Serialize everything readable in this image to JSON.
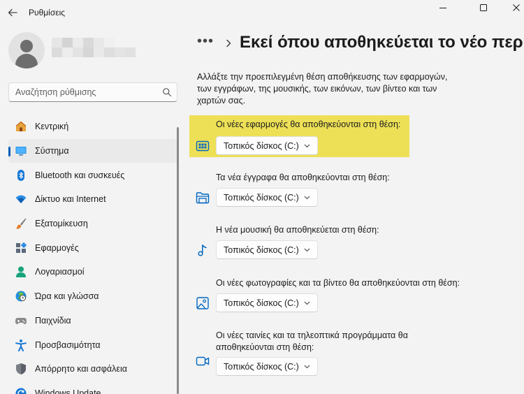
{
  "window": {
    "title": "Ρυθμίσεις"
  },
  "search": {
    "placeholder": "Αναζήτηση ρύθμισης"
  },
  "sidebar": {
    "items": [
      {
        "label": "Κεντρική",
        "icon": "home-icon"
      },
      {
        "label": "Σύστημα",
        "icon": "system-icon",
        "selected": true
      },
      {
        "label": "Bluetooth και συσκευές",
        "icon": "bluetooth-icon"
      },
      {
        "label": "Δίκτυο και Internet",
        "icon": "wifi-icon"
      },
      {
        "label": "Εξατομίκευση",
        "icon": "brush-icon"
      },
      {
        "label": "Εφαρμογές",
        "icon": "apps-icon"
      },
      {
        "label": "Λογαριασμοί",
        "icon": "account-icon"
      },
      {
        "label": "Ώρα και γλώσσα",
        "icon": "time-language-icon"
      },
      {
        "label": "Παιχνίδια",
        "icon": "gamepad-icon"
      },
      {
        "label": "Προσβασιμότητα",
        "icon": "accessibility-icon"
      },
      {
        "label": "Απόρρητο και ασφάλεια",
        "icon": "shield-icon"
      },
      {
        "label": "Windows Update",
        "icon": "update-icon"
      }
    ]
  },
  "header": {
    "breadcrumb_more": "•••",
    "title": "Εκεί όπου αποθηκεύεται το νέο περιεχόμενο"
  },
  "main": {
    "description": "Αλλάξτε την προεπιλεγμένη θέση αποθήκευσης των εφαρμογών, των εγγράφων, της μουσικής, των εικόνων, των βίντεο και των χαρτών σας.",
    "settings": [
      {
        "label": "Οι νέες εφαρμογές θα αποθηκεύονται στη θέση:",
        "value": "Τοπικός δίσκος (C:)",
        "icon": "apps-drive-icon",
        "highlighted": true
      },
      {
        "label": "Τα νέα έγγραφα θα αποθηκεύονται στη θέση:",
        "value": "Τοπικός δίσκος (C:)",
        "icon": "documents-folder-icon"
      },
      {
        "label": "Η νέα μουσική θα αποθηκεύεται στη θέση:",
        "value": "Τοπικός δίσκος (C:)",
        "icon": "music-note-icon"
      },
      {
        "label": "Οι νέες φωτογραφίες και τα βίντεο θα αποθηκεύονται στη θέση:",
        "value": "Τοπικός δίσκος (C:)",
        "icon": "photo-icon"
      },
      {
        "label": "Οι νέες ταινίες και τα τηλεοπτικά προγράμματα θα αποθηκεύονται στη θέση:",
        "value": "Τοπικός δίσκος (C:)",
        "icon": "video-camera-icon"
      }
    ]
  },
  "colors": {
    "accent": "#005fb8",
    "highlight": "#ede057",
    "background": "#f3f3f3"
  }
}
